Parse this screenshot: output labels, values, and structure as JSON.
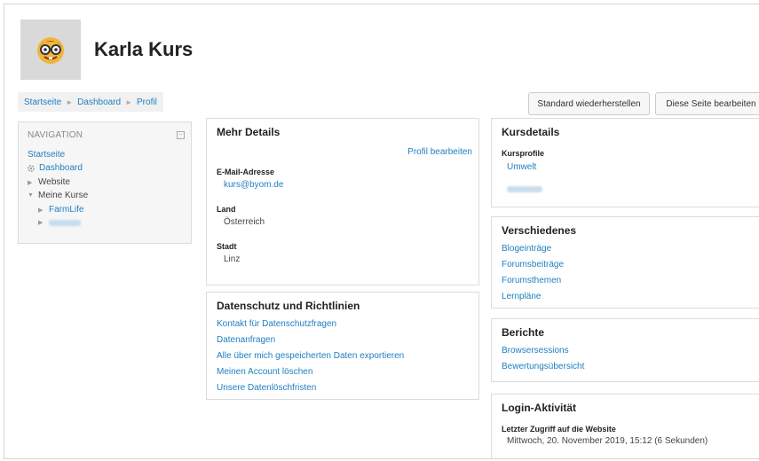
{
  "header": {
    "user_name": "Karla Kurs",
    "avatar_icon": "nerd-face-emoji-icon"
  },
  "breadcrumb": {
    "items": [
      "Startseite",
      "Dashboard",
      "Profil"
    ],
    "separator": "►"
  },
  "actions": {
    "reset_label": "Standard wiederherstellen",
    "edit_label": "Diese Seite bearbeiten"
  },
  "navigation": {
    "title": "NAVIGATION",
    "collapse_icon": "collapse-icon",
    "startseite": "Startseite",
    "dashboard": "Dashboard",
    "website": "Website",
    "meine_kurse": "Meine Kurse",
    "farmlife": "FarmLife"
  },
  "details": {
    "title": "Mehr Details",
    "edit_link": "Profil bearbeiten",
    "email_label": "E-Mail-Adresse",
    "email_value": "kurs@byom.de",
    "land_label": "Land",
    "land_value": "Österreich",
    "stadt_label": "Stadt",
    "stadt_value": "Linz"
  },
  "privacy": {
    "title": "Datenschutz und Richtlinien",
    "links": [
      "Kontakt für Datenschutzfragen",
      "Datenanfragen",
      "Alle über mich gespeicherten Daten exportieren",
      "Meinen Account löschen",
      "Unsere Datenlöschfristen"
    ]
  },
  "courses": {
    "title": "Kursdetails",
    "profiles_label": "Kursprofile",
    "course1": "Umwelt"
  },
  "misc": {
    "title": "Verschiedenes",
    "links": [
      "Blogeinträge",
      "Forumsbeiträge",
      "Forumsthemen",
      "Lernpläne"
    ]
  },
  "reports": {
    "title": "Berichte",
    "links": [
      "Browsersessions",
      "Bewertungsübersicht"
    ]
  },
  "login": {
    "title": "Login-Aktivität",
    "last_access_label": "Letzter Zugriff auf die Website",
    "last_access_value": "Mittwoch, 20. November 2019, 15:12  (6 Sekunden)"
  },
  "colors": {
    "link": "#1f7ec1",
    "nav_bg": "#f6f6f6",
    "breadcrumb_bg": "#f1f1f1"
  }
}
